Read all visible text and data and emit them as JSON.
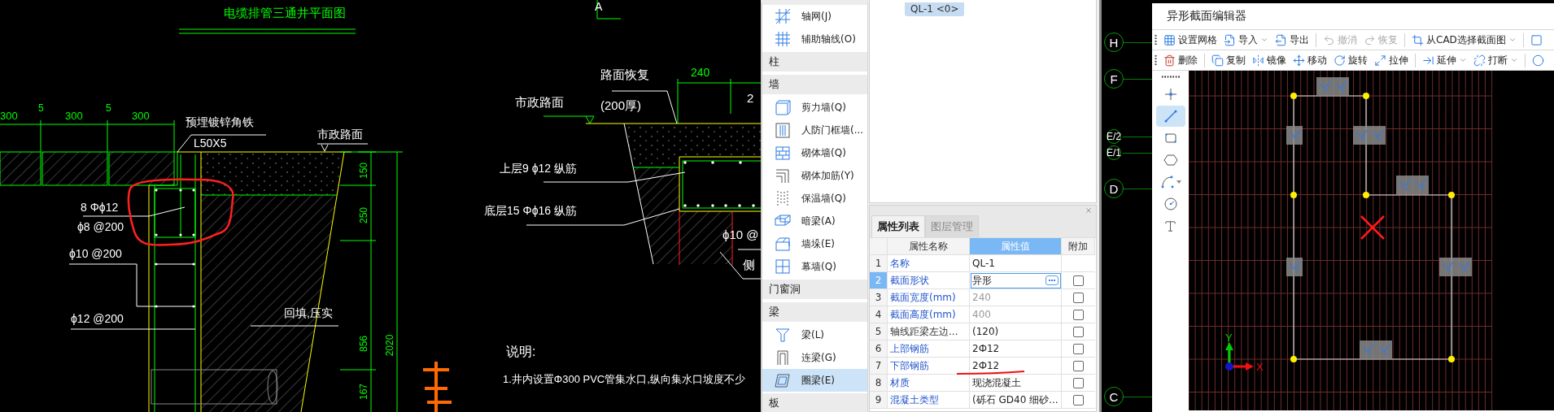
{
  "cad_view": {
    "labels": [
      {
        "text": "电缆排管三通井平面图",
        "kind": "title"
      },
      {
        "text": "300",
        "kind": "dimension"
      },
      {
        "text": "5",
        "kind": "dimension"
      },
      {
        "text": "300",
        "kind": "dimension"
      },
      {
        "text": "5",
        "kind": "dimension"
      },
      {
        "text": "300",
        "kind": "dimension"
      },
      {
        "text": "预埋镀锌角铁",
        "kind": "label"
      },
      {
        "text": "L50X5",
        "kind": "label"
      },
      {
        "text": "市政路面",
        "kind": "label"
      },
      {
        "text": "8 Φϕ12",
        "kind": "label"
      },
      {
        "text": "ϕ8 @200",
        "kind": "label"
      },
      {
        "text": "ϕ10 @200",
        "kind": "label"
      },
      {
        "text": "ϕ12 @200",
        "kind": "label"
      },
      {
        "text": "回填,压实",
        "kind": "label"
      },
      {
        "text": "150",
        "kind": "vertical_dimension"
      },
      {
        "text": "250",
        "kind": "vertical_dimension"
      },
      {
        "text": "856",
        "kind": "vertical_dimension"
      },
      {
        "text": "167",
        "kind": "vertical_dimension"
      },
      {
        "text": "2020",
        "kind": "vertical_dimension"
      },
      {
        "text": "A",
        "kind": "label"
      },
      {
        "text": "路面恢复",
        "kind": "label"
      },
      {
        "text": "市政路面",
        "kind": "label"
      },
      {
        "text": "(200厚)",
        "kind": "label"
      },
      {
        "text": "240",
        "kind": "dimension"
      },
      {
        "text": "2",
        "kind": "label"
      },
      {
        "text": "上层9 ϕ12 纵筋",
        "kind": "label"
      },
      {
        "text": "底层15 Φϕ16 纵筋",
        "kind": "label"
      },
      {
        "text": "ϕ10 @",
        "kind": "label"
      },
      {
        "text": "侧",
        "kind": "label"
      },
      {
        "text": "说明:",
        "kind": "label"
      },
      {
        "text": "1.井内设置Φ300 PVC管集水口,纵向集水口坡度不少",
        "kind": "label"
      }
    ]
  },
  "palette": [
    {
      "kind": "item",
      "label": "轴网(J)",
      "selected": false
    },
    {
      "kind": "item",
      "label": "辅助轴线(O)",
      "selected": false
    },
    {
      "kind": "section",
      "label": "柱",
      "selected": false
    },
    {
      "kind": "section",
      "label": "墙",
      "selected": false
    },
    {
      "kind": "item",
      "label": "剪力墙(Q)",
      "selected": false
    },
    {
      "kind": "item",
      "label": "人防门框墙(...",
      "selected": false
    },
    {
      "kind": "item",
      "label": "砌体墙(Q)",
      "selected": false
    },
    {
      "kind": "item",
      "label": "砌体加筋(Y)",
      "selected": false
    },
    {
      "kind": "item",
      "label": "保温墙(Q)",
      "selected": false
    },
    {
      "kind": "item",
      "label": "暗梁(A)",
      "selected": false
    },
    {
      "kind": "item",
      "label": "墙垛(E)",
      "selected": false
    },
    {
      "kind": "item",
      "label": "幕墙(Q)",
      "selected": false
    },
    {
      "kind": "section",
      "label": "门窗洞",
      "selected": false
    },
    {
      "kind": "section",
      "label": "梁",
      "selected": false
    },
    {
      "kind": "item",
      "label": "梁(L)",
      "selected": false
    },
    {
      "kind": "item",
      "label": "连梁(G)",
      "selected": false
    },
    {
      "kind": "item",
      "label": "圈梁(E)",
      "selected": true
    },
    {
      "kind": "section",
      "label": "板",
      "selected": false
    }
  ],
  "element_chip": "QL-1 <0>",
  "properties": {
    "tabs": [
      {
        "label": "属性列表",
        "selected": true
      },
      {
        "label": "图层管理",
        "selected": false
      }
    ],
    "columns": [
      "属性名称",
      "属性值",
      "附加"
    ],
    "rows": [
      {
        "index": "1",
        "name": "名称",
        "value": "QL-1",
        "kind": "plain",
        "link": true,
        "dimmed": false,
        "selected": false
      },
      {
        "index": "2",
        "name": "截面形状",
        "value": "异形",
        "kind": "option",
        "link": true,
        "dimmed": false,
        "selected": true,
        "checked": false
      },
      {
        "index": "3",
        "name": "截面宽度(mm)",
        "value": "240",
        "kind": "option",
        "link": true,
        "dimmed": true,
        "selected": false,
        "checked": false
      },
      {
        "index": "4",
        "name": "截面高度(mm)",
        "value": "400",
        "kind": "option",
        "link": true,
        "dimmed": true,
        "selected": false,
        "checked": false
      },
      {
        "index": "5",
        "name": "轴线距梁左边...",
        "value": "(120)",
        "kind": "option",
        "link": false,
        "dimmed": false,
        "selected": false,
        "checked": false
      },
      {
        "index": "6",
        "name": "上部钢筋",
        "value": "2Ф12",
        "kind": "option",
        "link": true,
        "dimmed": false,
        "selected": false,
        "checked": false
      },
      {
        "index": "7",
        "name": "下部钢筋",
        "value": "2Ф12",
        "kind": "option",
        "link": true,
        "dimmed": false,
        "selected": false,
        "checked": false
      },
      {
        "index": "8",
        "name": "材质",
        "value": "现浇混凝土",
        "kind": "option",
        "link": true,
        "dimmed": false,
        "selected": false,
        "checked": false
      },
      {
        "index": "9",
        "name": "混凝土类型",
        "value": "(砾石 GD40 细砂...",
        "kind": "option",
        "link": true,
        "dimmed": false,
        "selected": false,
        "checked": false
      }
    ]
  },
  "axis_bubbles": [
    "H",
    "F",
    "E/2",
    "E/1",
    "D",
    "C"
  ],
  "editor": {
    "title": "异形截面编辑器",
    "toolbars": [
      {
        "groups": [
          [
            {
              "label": "设置网格",
              "dropdown": false,
              "disabled": false
            },
            {
              "label": "导入",
              "dropdown": true,
              "disabled": false
            },
            {
              "label": "导出",
              "dropdown": false,
              "disabled": false
            }
          ],
          [
            {
              "label": "撤消",
              "dropdown": false,
              "disabled": true
            },
            {
              "label": "恢复",
              "dropdown": false,
              "disabled": true
            }
          ],
          [
            {
              "label": "从CAD选择截面图",
              "dropdown": true,
              "disabled": false
            }
          ],
          [
            {
              "dropdown": false,
              "disabled": false
            }
          ]
        ]
      },
      {
        "groups": [
          [
            {
              "label": "删除",
              "dropdown": false,
              "disabled": false
            }
          ],
          [
            {
              "label": "复制",
              "dropdown": false,
              "disabled": false
            },
            {
              "label": "镜像",
              "dropdown": false,
              "disabled": false
            },
            {
              "label": "移动",
              "dropdown": false,
              "disabled": false
            },
            {
              "label": "旋转",
              "dropdown": false,
              "disabled": false
            },
            {
              "label": "拉伸",
              "dropdown": false,
              "disabled": false
            }
          ],
          [
            {
              "label": "延伸",
              "dropdown": true,
              "disabled": false
            },
            {
              "label": "打断",
              "dropdown": true,
              "disabled": false
            }
          ],
          [
            {
              "dropdown": false,
              "disabled": false
            }
          ]
        ]
      }
    ],
    "tools": [
      {
        "selected": false,
        "dropdown": false
      },
      {
        "selected": true,
        "dropdown": false
      },
      {
        "selected": false,
        "dropdown": false
      },
      {
        "selected": false,
        "dropdown": false
      },
      {
        "selected": false,
        "dropdown": true
      },
      {
        "selected": false,
        "dropdown": false
      },
      {
        "selected": false,
        "dropdown": false
      }
    ],
    "axis_labels": {
      "x": "X",
      "y": "Y"
    }
  }
}
